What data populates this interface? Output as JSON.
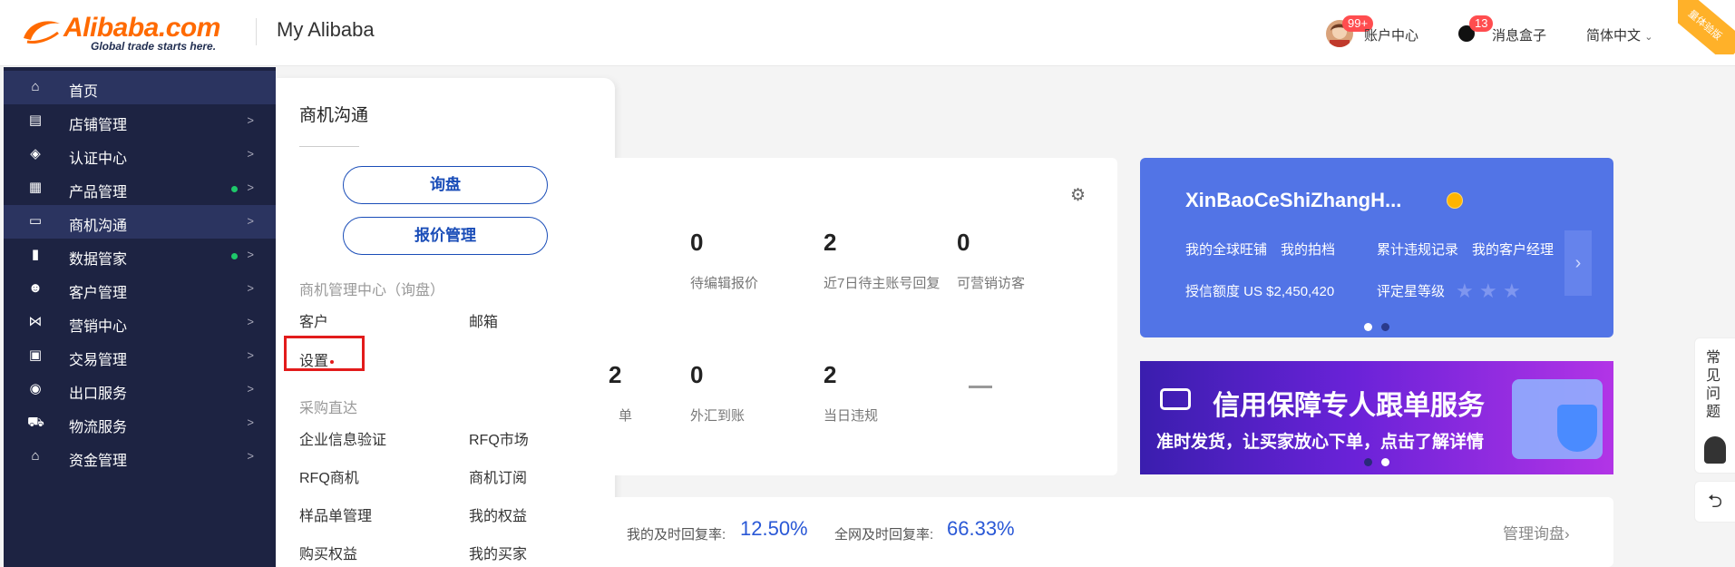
{
  "header": {
    "logo_text": "Alibaba.com",
    "logo_tagline": "Global trade starts here.",
    "app_title": "My Alibaba",
    "account_badge": "99+",
    "account_label": "账户中心",
    "messages_badge": "13",
    "messages_label": "消息盒子",
    "language_label": "简体中文",
    "corner_ribbon": "量体验版"
  },
  "sidebar": {
    "items": [
      {
        "label": "首页",
        "icon": "home-icon",
        "glyph": "⌂",
        "arrow": "",
        "dot": false
      },
      {
        "label": "店铺管理",
        "icon": "store-icon",
        "glyph": "▤",
        "arrow": ">",
        "dot": false
      },
      {
        "label": "认证中心",
        "icon": "shield-check-icon",
        "glyph": "◈",
        "arrow": ">",
        "dot": false
      },
      {
        "label": "产品管理",
        "icon": "grid-icon",
        "glyph": "▦",
        "arrow": ">",
        "dot": true
      },
      {
        "label": "商机沟通",
        "icon": "chat-icon",
        "glyph": "▭",
        "arrow": ">",
        "dot": false
      },
      {
        "label": "数据管家",
        "icon": "bar-chart-icon",
        "glyph": "▮",
        "arrow": ">",
        "dot": true
      },
      {
        "label": "客户管理",
        "icon": "users-icon",
        "glyph": "☻",
        "arrow": ">",
        "dot": false
      },
      {
        "label": "营销中心",
        "icon": "share-icon",
        "glyph": "⋈",
        "arrow": ">",
        "dot": false
      },
      {
        "label": "交易管理",
        "icon": "clipboard-icon",
        "glyph": "▣",
        "arrow": ">",
        "dot": false
      },
      {
        "label": "出口服务",
        "icon": "globe-icon",
        "glyph": "◉",
        "arrow": ">",
        "dot": false
      },
      {
        "label": "物流服务",
        "icon": "truck-icon",
        "glyph": "⛟",
        "arrow": ">",
        "dot": false
      },
      {
        "label": "资金管理",
        "icon": "bank-icon",
        "glyph": "⌂",
        "arrow": ">",
        "dot": false
      }
    ]
  },
  "flyout": {
    "title": "商机沟通",
    "buttons": [
      "询盘",
      "报价管理"
    ],
    "section1": "商机管理中心（询盘）",
    "links1": [
      "客户",
      "邮箱",
      "设置"
    ],
    "section2": "采购直达",
    "links2": [
      "企业信息验证",
      "RFQ市场",
      "RFQ商机",
      "商机订阅",
      "样品单管理",
      "我的权益",
      "购买权益",
      "我的买家"
    ]
  },
  "stats": {
    "row1": [
      {
        "num": "0",
        "label": "待编辑报价"
      },
      {
        "num": "2",
        "label": "近7日待主账号回复"
      },
      {
        "num": "0",
        "label": "可营销访客"
      }
    ],
    "row2_partial": {
      "num": "2",
      "label": "单"
    },
    "row2": [
      {
        "num": "0",
        "label": "外汇到账"
      },
      {
        "num": "2",
        "label": "当日违规"
      }
    ]
  },
  "profile": {
    "name": "XinBaoCeShiZhangH...",
    "links": [
      "我的全球旺铺",
      "我的拍档",
      "累计违规记录",
      "我的客户经理"
    ],
    "credit": "授信额度 US $2,450,420",
    "rating_label": "评定星等级",
    "stars": 3,
    "star_glyph": "★",
    "next_glyph": "›"
  },
  "banner": {
    "title": "信用保障专人跟单服务",
    "subtitle": "准时发货，让买家放心下单，点击了解详情"
  },
  "reply": {
    "my_label": "我的及时回复率:",
    "my_value": "12.50%",
    "all_label": "全网及时回复率:",
    "all_value": "66.33%",
    "manage": "管理询盘",
    "manage_arrow": "›"
  },
  "help": {
    "text": "常见问题",
    "back_glyph": "⮌"
  },
  "colors": {
    "sidebar_bg": "#1d2342",
    "accent_blue": "#1a4db8",
    "profile_bg": "#5274e6",
    "brand_orange": "#ff6a00",
    "highlight_red": "#e21b1b"
  }
}
